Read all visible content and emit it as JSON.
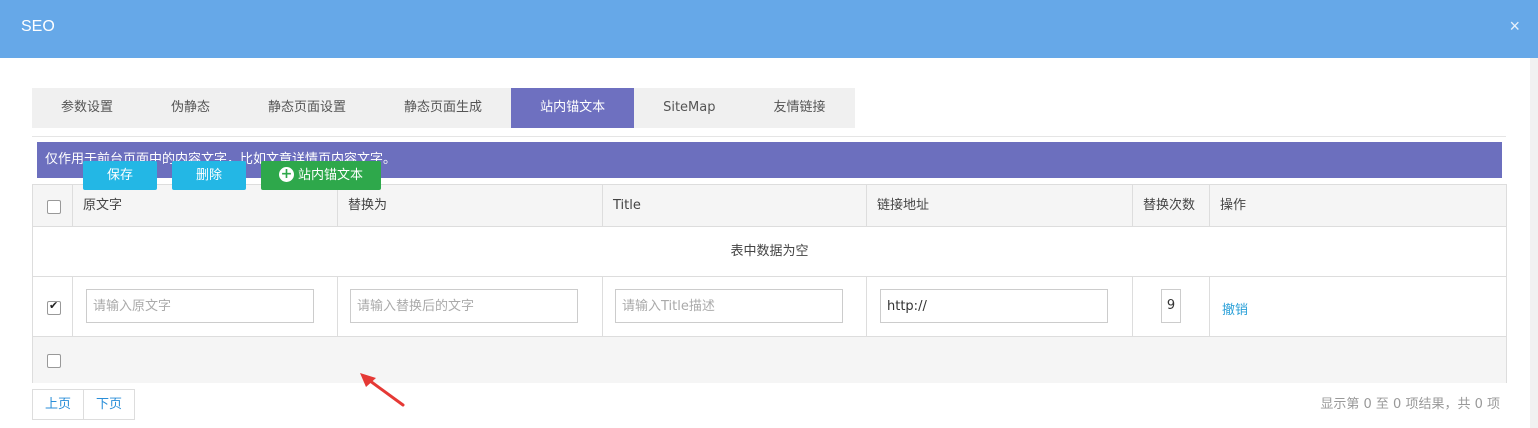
{
  "dialog": {
    "title": "SEO",
    "close_glyph": "×"
  },
  "tabs": [
    {
      "label": "参数设置",
      "active": false
    },
    {
      "label": "伪静态",
      "active": false
    },
    {
      "label": "静态页面设置",
      "active": false
    },
    {
      "label": "静态页面生成",
      "active": false
    },
    {
      "label": "站内锚文本",
      "active": true
    },
    {
      "label": "SiteMap",
      "active": false
    },
    {
      "label": "友情链接",
      "active": false
    }
  ],
  "notice": "仅作用于前台页面中的内容文字，比如文章详情页内容文字。",
  "table": {
    "headers": [
      "原文字",
      "替换为",
      "Title",
      "链接地址",
      "替换次数",
      "操作"
    ],
    "empty_message": "表中数据为空",
    "new_row": {
      "checked": true,
      "original_placeholder": "请输入原文字",
      "replace_placeholder": "请输入替换后的文字",
      "title_placeholder": "请输入Title描述",
      "url_value": "http://",
      "count_value": "9",
      "cancel_label": "撤销"
    }
  },
  "actions": {
    "save_label": "保存",
    "delete_label": "删除",
    "add_label": "站内锚文本"
  },
  "pager": {
    "prev_label": "上页",
    "next_label": "下页"
  },
  "info": "显示第 0 至 0 项结果，共 0 项",
  "colors": {
    "header": "#66a8e8",
    "tab_active": "#6e70c0",
    "notice": "#6c6fbe",
    "btn_blue": "#23b7e5",
    "btn_green": "#2ea84b",
    "annotation_arrow": "#e53935"
  }
}
